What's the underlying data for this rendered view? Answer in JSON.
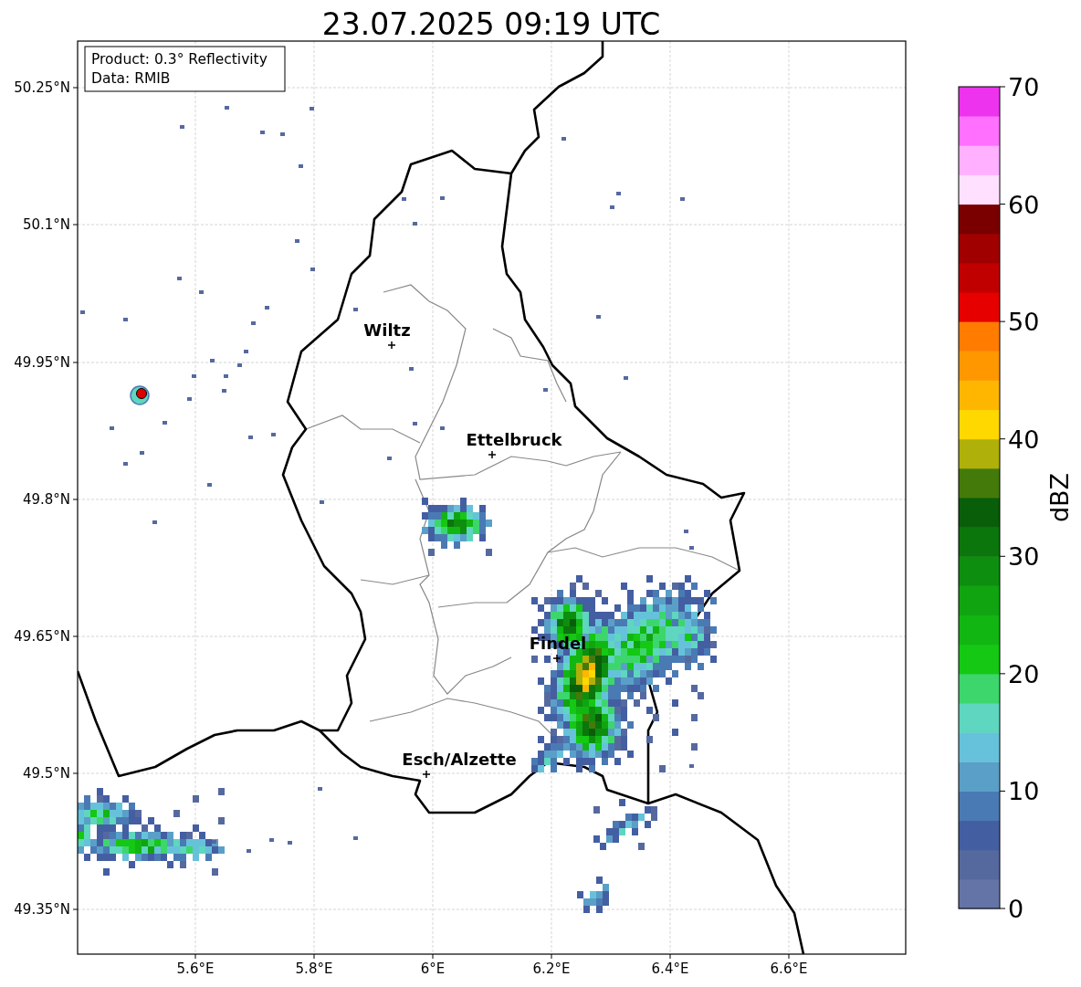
{
  "title": "23.07.2025 09:19 UTC",
  "info_box": [
    "Product: 0.3° Reflectivity",
    "Data: RMIB"
  ],
  "map": {
    "cities": [
      {
        "name": "Wiltz"
      },
      {
        "name": "Ettelbruck"
      },
      {
        "name": "Findel"
      },
      {
        "name": "Esch/Alzette"
      }
    ]
  },
  "y_axis": {
    "ticks": [
      "50.25°N",
      "50.1°N",
      "49.95°N",
      "49.8°N",
      "49.65°N",
      "49.5°N",
      "49.35°N"
    ]
  },
  "x_axis": {
    "ticks": [
      "5.6°E",
      "5.8°E",
      "6°E",
      "6.2°E",
      "6.4°E",
      "6.6°E"
    ]
  },
  "colorbar": {
    "label": "dBZ",
    "ticks": [
      "70",
      "60",
      "50",
      "40",
      "30",
      "20",
      "10",
      "0"
    ],
    "bands": [
      {
        "color": "#6474a6"
      },
      {
        "color": "#56699f"
      },
      {
        "color": "#445ea2"
      },
      {
        "color": "#4a7ab3"
      },
      {
        "color": "#5a9fc8"
      },
      {
        "color": "#66c2da"
      },
      {
        "color": "#5fd6bf"
      },
      {
        "color": "#3dd66c"
      },
      {
        "color": "#14c814"
      },
      {
        "color": "#12b612"
      },
      {
        "color": "#10a510"
      },
      {
        "color": "#0e8e0e"
      },
      {
        "color": "#0b760b"
      },
      {
        "color": "#095e09"
      },
      {
        "color": "#447a0a"
      },
      {
        "color": "#b0b00a"
      },
      {
        "color": "#ffd800"
      },
      {
        "color": "#ffb600"
      },
      {
        "color": "#ff9800"
      },
      {
        "color": "#ff7c00"
      },
      {
        "color": "#e60000"
      },
      {
        "color": "#c00000"
      },
      {
        "color": "#a00000"
      },
      {
        "color": "#7a0000"
      },
      {
        "color": "#ffe0ff"
      },
      {
        "color": "#ffb0ff"
      },
      {
        "color": "#ff70ff"
      },
      {
        "color": "#ee33ee"
      }
    ]
  }
}
